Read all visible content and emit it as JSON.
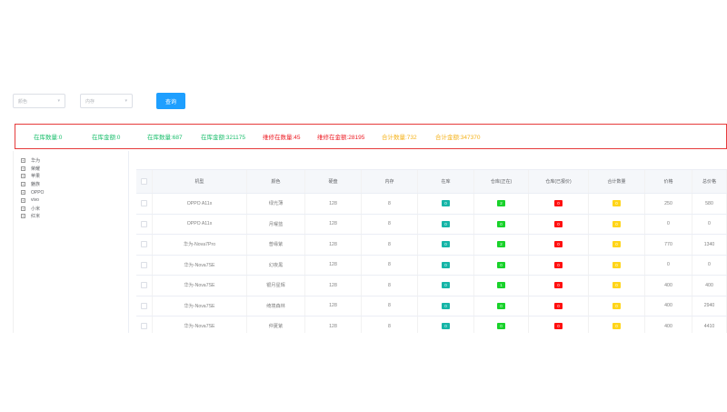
{
  "filters": {
    "select1": "颜色",
    "select2": "内存",
    "query_button": "查询"
  },
  "stats": [
    {
      "label": "在库数量:0",
      "color": "#19be6b"
    },
    {
      "label": "在库金额:0",
      "color": "#19be6b"
    },
    {
      "label": "在库数量:687",
      "color": "#19be6b"
    },
    {
      "label": "在库金额:321175",
      "color": "#19be6b"
    },
    {
      "label": "维修在数量:45",
      "color": "#ed1c24"
    },
    {
      "label": "维修在金额:28195",
      "color": "#ed1c24"
    },
    {
      "label": "合计数量:732",
      "color": "#f5b21a"
    },
    {
      "label": "合计金额:347370",
      "color": "#f5b21a"
    }
  ],
  "tree": [
    "华为",
    "荣耀",
    "苹果",
    "魅族",
    "OPPO",
    "vivo",
    "小米",
    "红米"
  ],
  "table": {
    "headers": [
      "机型",
      "颜色",
      "硬盘",
      "内存",
      "在库",
      "仓库(正在)",
      "仓库(已报价)",
      "合计数量",
      "价格",
      "总价格"
    ],
    "rows": [
      {
        "model": "OPPO A11x",
        "color": "绿光薄",
        "disk": "128",
        "mem": "8",
        "instock": "0",
        "wh1": "2",
        "wh2": "0",
        "total": "0",
        "price": "250",
        "amount": "580"
      },
      {
        "model": "OPPO A11x",
        "color": "月曜蓝",
        "disk": "128",
        "mem": "8",
        "instock": "0",
        "wh1": "0",
        "wh2": "0",
        "total": "0",
        "price": "0",
        "amount": "0"
      },
      {
        "model": "华为-Nova7Pro",
        "color": "普缘紫",
        "disk": "128",
        "mem": "8",
        "instock": "0",
        "wh1": "2",
        "wh2": "0",
        "total": "0",
        "price": "770",
        "amount": "1340"
      },
      {
        "model": "华为-Nova7SE",
        "color": "幻夜黑",
        "disk": "128",
        "mem": "8",
        "instock": "0",
        "wh1": "0",
        "wh2": "0",
        "total": "0",
        "price": "0",
        "amount": "0"
      },
      {
        "model": "华为-Nova7SE",
        "color": "银月星辉",
        "disk": "128",
        "mem": "8",
        "instock": "0",
        "wh1": "1",
        "wh2": "0",
        "total": "0",
        "price": "400",
        "amount": "400"
      },
      {
        "model": "华为-Nova7SE",
        "color": "绮境森林",
        "disk": "128",
        "mem": "8",
        "instock": "0",
        "wh1": "0",
        "wh2": "0",
        "total": "0",
        "price": "400",
        "amount": "2940"
      },
      {
        "model": "华为-Nova7SE",
        "color": "仲夏紫",
        "disk": "128",
        "mem": "8",
        "instock": "0",
        "wh1": "0",
        "wh2": "0",
        "total": "0",
        "price": "400",
        "amount": "4410"
      }
    ]
  }
}
